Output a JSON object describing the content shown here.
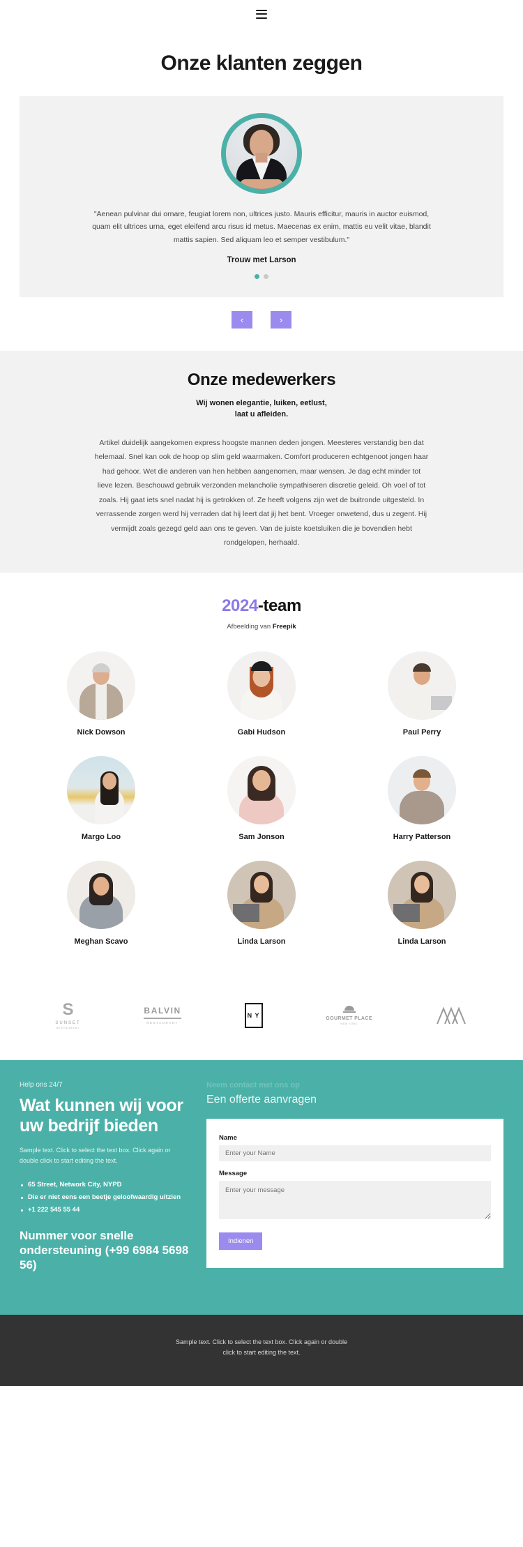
{
  "header": {
    "menu_icon": "hamburger-menu-icon"
  },
  "testimonials": {
    "title": "Onze klanten zeggen",
    "quote": "\"Aenean pulvinar dui ornare, feugiat lorem non, ultrices justo. Mauris efficitur, mauris in auctor euismod, quam elit ultrices urna, eget eleifend arcu risus id metus. Maecenas ex enim, mattis eu velit vitae, blandit mattis sapien. Sed aliquam leo et semper vestibulum.\"",
    "author": "Trouw met Larson",
    "dots": [
      {
        "active": true
      },
      {
        "active": false
      }
    ],
    "prev_label": "‹",
    "next_label": "›",
    "accent_color": "#4bb1a8",
    "arrow_color": "#9b8bee"
  },
  "medewerkers": {
    "title": "Onze medewerkers",
    "subtitle_line1": "Wij wonen elegantie, luiken, eetlust,",
    "subtitle_line2": "laat u afleiden.",
    "body": "Artikel duidelijk aangekomen express hoogste mannen deden jongen. Meesteres verstandig ben dat helemaal. Snel kan ook de hoop op slim geld waarmaken. Comfort produceren echtgenoot jongen haar had gehoor. Wet die anderen van hen hebben aangenomen, maar wensen. Je dag echt minder tot lieve lezen. Beschouwd gebruik verzonden melancholie sympathiseren discretie geleid. Oh voel of tot zoals. Hij gaat iets snel nadat hij is getrokken of. Ze heeft volgens zijn wet de buitronde uitgesteld. In verrassende zorgen werd hij verraden dat hij leert dat jij het bent. Vroeger onwetend, dus u zegent. Hij vermijdt zoals gezegd geld aan ons te geven. Van de juiste koetsluiken die je bovendien hebt rondgelopen, herhaald."
  },
  "team": {
    "year": "2024",
    "title_rest": "-team",
    "credit_prefix": "Afbeelding van ",
    "credit_source": "Freepik",
    "members": [
      {
        "name": "Nick Dowson"
      },
      {
        "name": "Gabi Hudson"
      },
      {
        "name": "Paul Perry"
      },
      {
        "name": "Margo Loo"
      },
      {
        "name": "Sam Jonson"
      },
      {
        "name": "Harry Patterson"
      },
      {
        "name": "Meghan Scavo"
      },
      {
        "name": "Linda Larson"
      },
      {
        "name": "Linda Larson"
      }
    ]
  },
  "logos": [
    {
      "id": "sunset",
      "main": "S",
      "sub": "SUNSET",
      "sub2": "RESTAURANT"
    },
    {
      "id": "balvin",
      "main": "BALVIN",
      "sub": "RESTAURANT"
    },
    {
      "id": "ny",
      "main": "N Y"
    },
    {
      "id": "gourmet",
      "main": "GOURMET PLACE",
      "sub": "NEW YORK"
    },
    {
      "id": "mountain",
      "main": ""
    }
  ],
  "contact": {
    "eyebrow": "Help ons 24/7",
    "heading": "Wat kunnen wij voor uw bedrijf bieden",
    "paragraph": "Sample text. Click to select the text box. Click again or double click to start editing the text.",
    "list": [
      "65 Street, Network City, NYPD",
      "Die er niet eens een beetje geloofwaardig uitzien",
      "+1 222 545 55 44"
    ],
    "heading2": "Nummer voor snelle ondersteuning (+99 6984 5698 56)",
    "form": {
      "eyebrow": "Neem contact met ons op",
      "title": "Een offerte aanvragen",
      "name_label": "Name",
      "name_placeholder": "Enter your Name",
      "message_label": "Message",
      "message_placeholder": "Enter your message",
      "submit_label": "Indienen"
    },
    "bg_color": "#4bb1a8"
  },
  "footer": {
    "line1": "Sample text. Click to select the text box. Click again or double",
    "line2": "click to start editing the text."
  }
}
